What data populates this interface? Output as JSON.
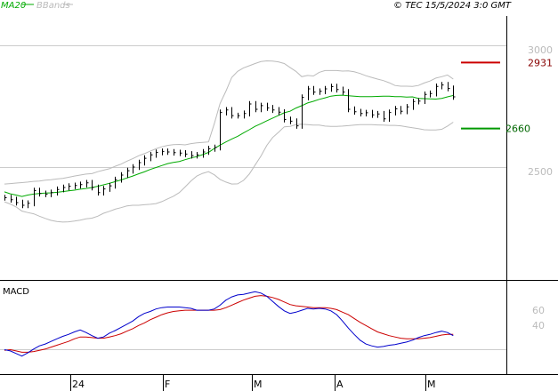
{
  "header": {
    "legend_ma": "MA20",
    "legend_bb": "BBands",
    "copyright": "© TEC 15/5/2024 3:0 GMT"
  },
  "macd_label": "MACD",
  "colors": {
    "price": "#000000",
    "ma": "#00aa00",
    "bbands": "#bbbbbb",
    "macd": "#0000cc",
    "signal": "#cc0000",
    "resistance": "#cc0000",
    "support": "#009900",
    "resistance_label": "#880000",
    "support_label": "#006600"
  },
  "chart_data": [
    {
      "type": "line",
      "title": "",
      "x_axis": {
        "tick_labels": [
          "24",
          "F",
          "M",
          "A",
          "M"
        ]
      },
      "y_axis": {
        "range": [
          2250,
          3050
        ],
        "tick_labels": [
          2500,
          3000
        ],
        "position": "right",
        "grid": true
      },
      "levels": [
        {
          "name": "resistance",
          "value": 2931,
          "label": "2931"
        },
        {
          "name": "support",
          "value": 2660,
          "label": "2660"
        }
      ],
      "series": [
        {
          "name": "price",
          "style": "hlc-bars",
          "close": [
            2376,
            2368,
            2356,
            2345,
            2353,
            2405,
            2393,
            2390,
            2397,
            2410,
            2418,
            2423,
            2426,
            2430,
            2437,
            2418,
            2397,
            2412,
            2425,
            2450,
            2469,
            2487,
            2502,
            2520,
            2538,
            2552,
            2562,
            2566,
            2564,
            2561,
            2559,
            2555,
            2549,
            2552,
            2564,
            2577,
            2582,
            2726,
            2736,
            2713,
            2713,
            2722,
            2761,
            2739,
            2754,
            2745,
            2736,
            2727,
            2697,
            2690,
            2671,
            2788,
            2823,
            2810,
            2813,
            2823,
            2832,
            2820,
            2810,
            2739,
            2729,
            2722,
            2725,
            2716,
            2720,
            2700,
            2726,
            2741,
            2731,
            2749,
            2771,
            2773,
            2800,
            2804,
            2833,
            2839,
            2825,
            2790
          ]
        },
        {
          "name": "MA20",
          "values": [
            2400,
            2392,
            2387,
            2381,
            2387,
            2391,
            2393,
            2395,
            2396,
            2398,
            2401,
            2404,
            2407,
            2411,
            2414,
            2418,
            2423,
            2429,
            2435,
            2442,
            2449,
            2457,
            2465,
            2474,
            2482,
            2492,
            2500,
            2508,
            2516,
            2521,
            2525,
            2532,
            2539,
            2545,
            2553,
            2562,
            2578,
            2592,
            2605,
            2617,
            2628,
            2642,
            2655,
            2669,
            2680,
            2692,
            2703,
            2714,
            2725,
            2731,
            2744,
            2754,
            2765,
            2772,
            2780,
            2786,
            2793,
            2796,
            2797,
            2795,
            2793,
            2791,
            2791,
            2791,
            2792,
            2793,
            2793,
            2791,
            2791,
            2789,
            2790,
            2784,
            2783,
            2782,
            2781,
            2784,
            2790,
            2796
          ]
        },
        {
          "name": "BBands upper",
          "values": [
            2432,
            2434,
            2436,
            2438,
            2440,
            2443,
            2444,
            2448,
            2450,
            2453,
            2455,
            2460,
            2465,
            2469,
            2473,
            2475,
            2483,
            2489,
            2495,
            2505,
            2514,
            2526,
            2536,
            2548,
            2557,
            2567,
            2577,
            2585,
            2591,
            2594,
            2595,
            2593,
            2598,
            2601,
            2603,
            2605,
            2680,
            2763,
            2814,
            2870,
            2895,
            2909,
            2918,
            2927,
            2935,
            2938,
            2937,
            2934,
            2927,
            2911,
            2895,
            2873,
            2878,
            2876,
            2891,
            2898,
            2898,
            2898,
            2896,
            2897,
            2893,
            2886,
            2877,
            2870,
            2863,
            2857,
            2848,
            2837,
            2834,
            2834,
            2833,
            2837,
            2847,
            2855,
            2867,
            2873,
            2880,
            2863
          ]
        },
        {
          "name": "BBands lower",
          "values": [
            2359,
            2350,
            2338,
            2321,
            2315,
            2310,
            2300,
            2291,
            2283,
            2278,
            2276,
            2277,
            2280,
            2284,
            2289,
            2292,
            2300,
            2312,
            2320,
            2329,
            2335,
            2342,
            2345,
            2345,
            2347,
            2349,
            2352,
            2360,
            2371,
            2382,
            2397,
            2420,
            2445,
            2465,
            2476,
            2483,
            2470,
            2451,
            2440,
            2432,
            2433,
            2447,
            2473,
            2510,
            2547,
            2591,
            2623,
            2644,
            2667,
            2669,
            2676,
            2678,
            2676,
            2674,
            2674,
            2670,
            2669,
            2669,
            2670,
            2672,
            2674,
            2676,
            2676,
            2676,
            2675,
            2674,
            2673,
            2673,
            2671,
            2667,
            2663,
            2660,
            2655,
            2654,
            2654,
            2657,
            2670,
            2686
          ]
        }
      ]
    },
    {
      "type": "line",
      "title": "MACD",
      "y_axis": {
        "range": [
          -10,
          100
        ],
        "tick_labels": [
          40,
          60
        ],
        "position": "right"
      },
      "series": [
        {
          "name": "MACD",
          "values": [
            0,
            -2,
            -6,
            -10,
            -5,
            1,
            6,
            9,
            13,
            17,
            21,
            24,
            28,
            31,
            27,
            22,
            18,
            20,
            26,
            30,
            35,
            40,
            45,
            52,
            57,
            60,
            64,
            66,
            67,
            67,
            67,
            66,
            65,
            62,
            62,
            62,
            64,
            70,
            78,
            83,
            86,
            87,
            89,
            91,
            89,
            84,
            76,
            68,
            61,
            57,
            59,
            62,
            65,
            64,
            65,
            64,
            61,
            55,
            45,
            34,
            24,
            15,
            9,
            6,
            4,
            5,
            7,
            8,
            10,
            12,
            15,
            19,
            22,
            24,
            27,
            29,
            27,
            22
          ]
        },
        {
          "name": "Signal",
          "values": [
            -1,
            0,
            -2,
            -4,
            -4,
            -3,
            -1,
            1,
            4,
            7,
            10,
            13,
            17,
            20,
            20,
            19,
            18,
            18,
            20,
            22,
            25,
            29,
            33,
            38,
            42,
            47,
            51,
            55,
            58,
            60,
            61,
            62,
            62,
            62,
            62,
            62,
            62,
            63,
            66,
            70,
            74,
            78,
            81,
            84,
            85,
            84,
            82,
            79,
            75,
            71,
            69,
            68,
            67,
            66,
            66,
            66,
            65,
            63,
            59,
            55,
            49,
            43,
            38,
            33,
            28,
            25,
            22,
            20,
            18,
            17,
            17,
            17,
            18,
            19,
            21,
            23,
            24,
            24
          ]
        }
      ]
    }
  ]
}
